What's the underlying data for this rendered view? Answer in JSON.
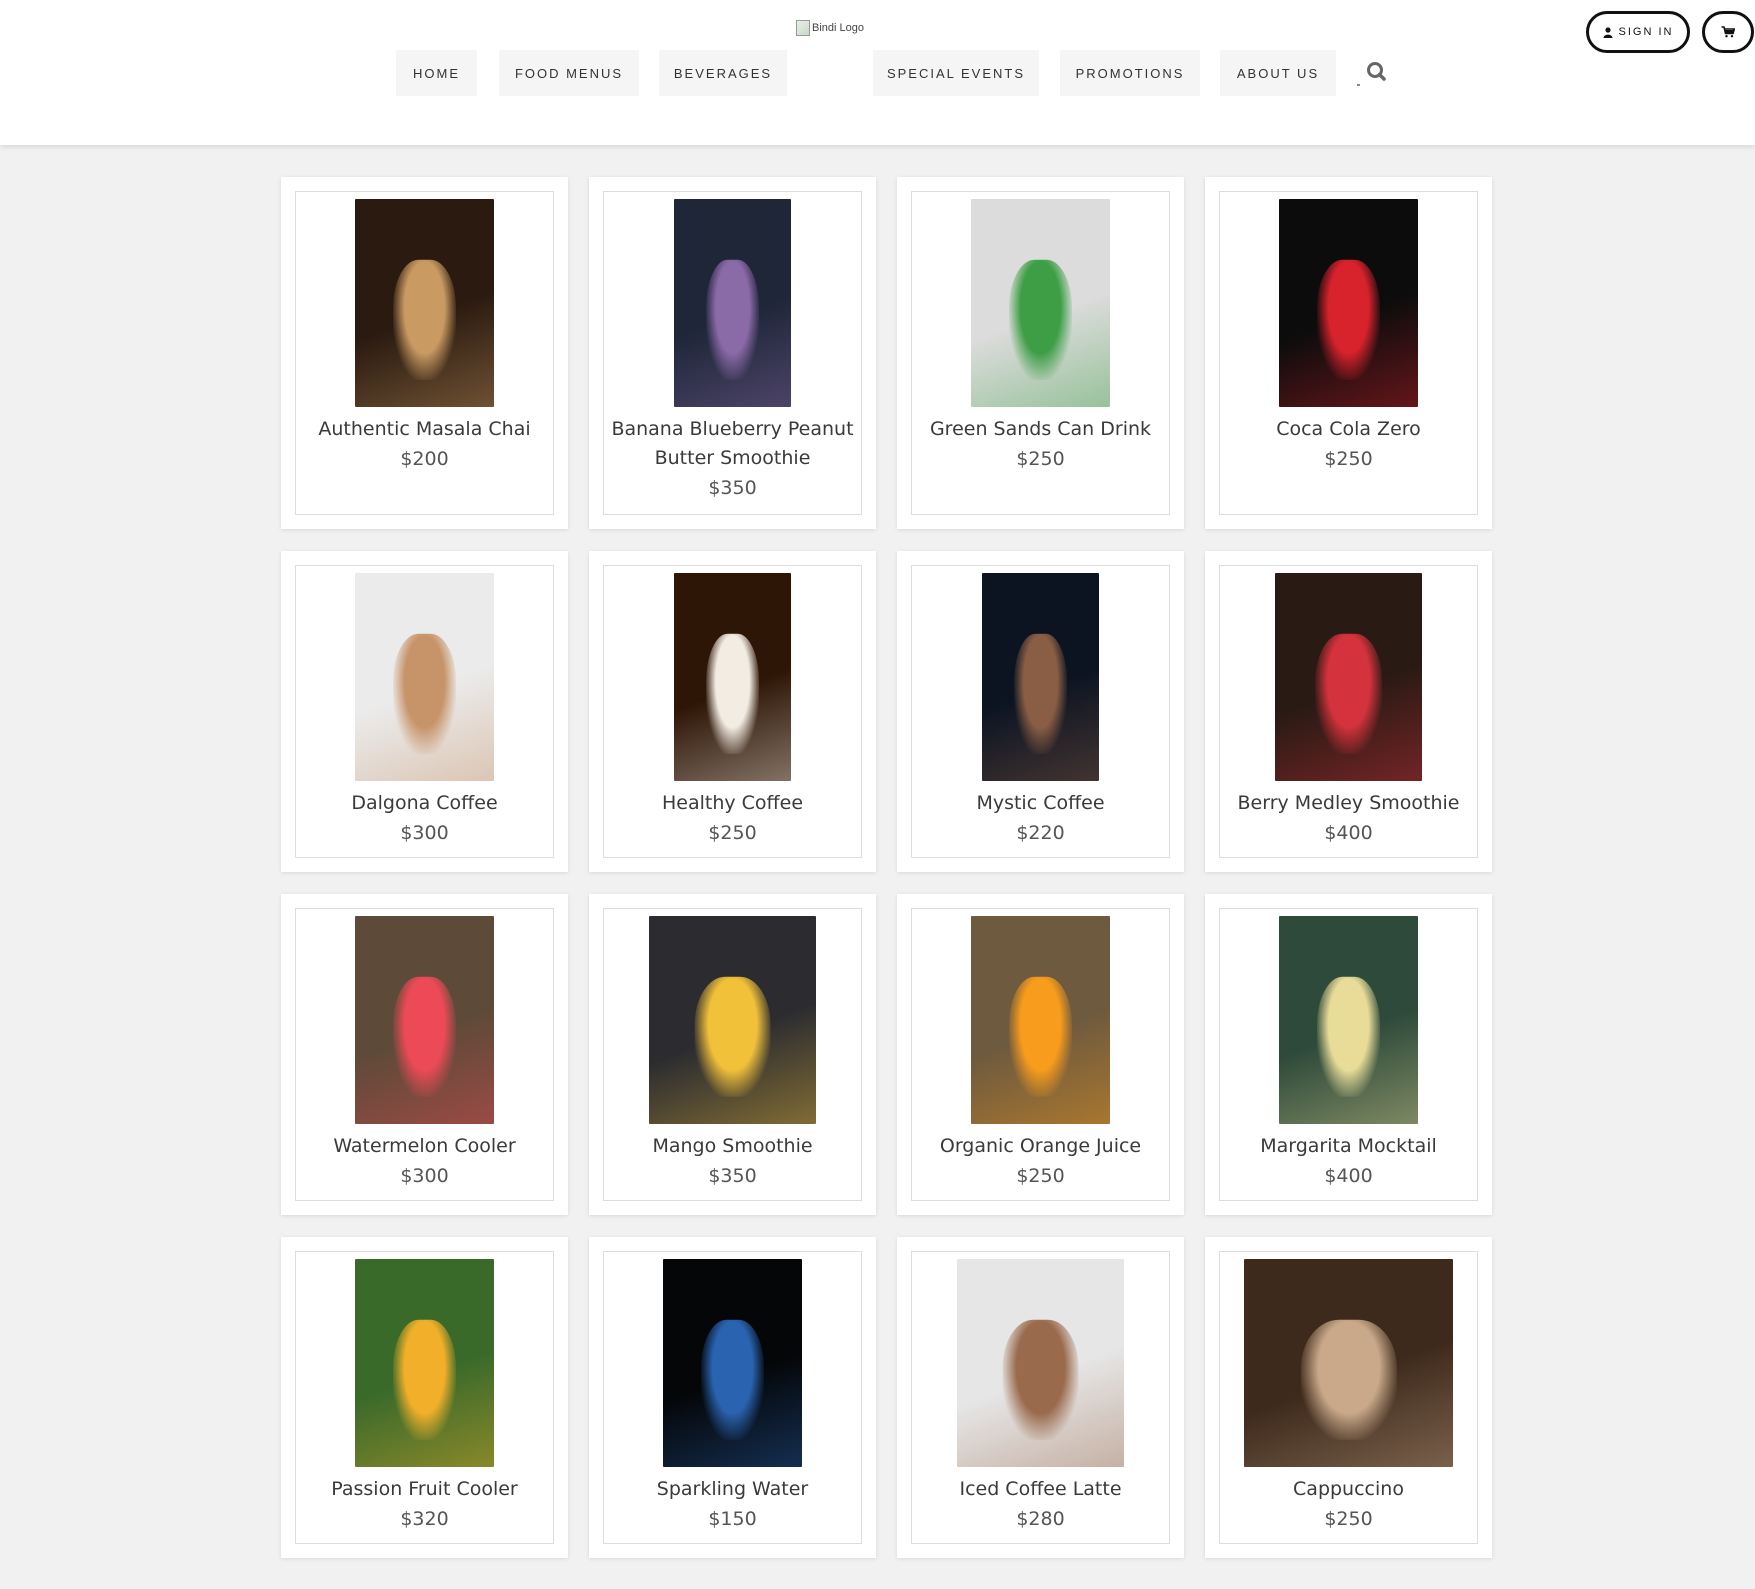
{
  "header": {
    "logo_alt": "Bindi Logo",
    "nav": [
      "HOME",
      "FOOD MENUS",
      "BEVERAGES",
      "SPECIAL EVENTS",
      "PROMOTIONS",
      "ABOUT US"
    ],
    "sign_in_label": "SIGN IN"
  },
  "products": [
    {
      "name": "Authentic Masala Chai",
      "price": "$200",
      "colors": [
        "#2a1a10",
        "#c99a62"
      ]
    },
    {
      "name": "Banana Blueberry Peanut Butter Smoothie",
      "price": "$350",
      "colors": [
        "#1e2638",
        "#8b6aa8"
      ]
    },
    {
      "name": "Green Sands Can Drink",
      "price": "$250",
      "colors": [
        "#dcdcdc",
        "#3d9e45"
      ]
    },
    {
      "name": "Coca Cola Zero",
      "price": "$250",
      "colors": [
        "#0c0c0c",
        "#d8222c"
      ]
    },
    {
      "name": "Dalgona Coffee",
      "price": "$300",
      "colors": [
        "#ebebeb",
        "#c7946a"
      ]
    },
    {
      "name": "Healthy Coffee",
      "price": "$250",
      "colors": [
        "#2e1606",
        "#f2ece3"
      ]
    },
    {
      "name": "Mystic Coffee",
      "price": "$220",
      "colors": [
        "#0c1422",
        "#8a5e44"
      ]
    },
    {
      "name": "Berry Medley Smoothie",
      "price": "$400",
      "colors": [
        "#2a1a14",
        "#d4323c"
      ]
    },
    {
      "name": "Watermelon Cooler",
      "price": "$300",
      "colors": [
        "#5e4a38",
        "#ec4a56"
      ]
    },
    {
      "name": "Mango Smoothie",
      "price": "$350",
      "colors": [
        "#2c2c30",
        "#f2c13a"
      ]
    },
    {
      "name": "Organic Orange Juice",
      "price": "$250",
      "colors": [
        "#6e5a3e",
        "#f79c1c"
      ]
    },
    {
      "name": "Margarita Mocktail",
      "price": "$400",
      "colors": [
        "#2e4a3a",
        "#e8dc98"
      ]
    },
    {
      "name": "Passion Fruit Cooler",
      "price": "$320",
      "colors": [
        "#3a6a2a",
        "#f2b02a"
      ]
    },
    {
      "name": "Sparkling Water",
      "price": "$150",
      "colors": [
        "#040608",
        "#2a63b0"
      ]
    },
    {
      "name": "Iced Coffee Latte",
      "price": "$280",
      "colors": [
        "#e6e6e6",
        "#9a6a4c"
      ]
    },
    {
      "name": "Cappuccino",
      "price": "$250",
      "colors": [
        "#3e2a1c",
        "#c9a98a"
      ]
    }
  ]
}
